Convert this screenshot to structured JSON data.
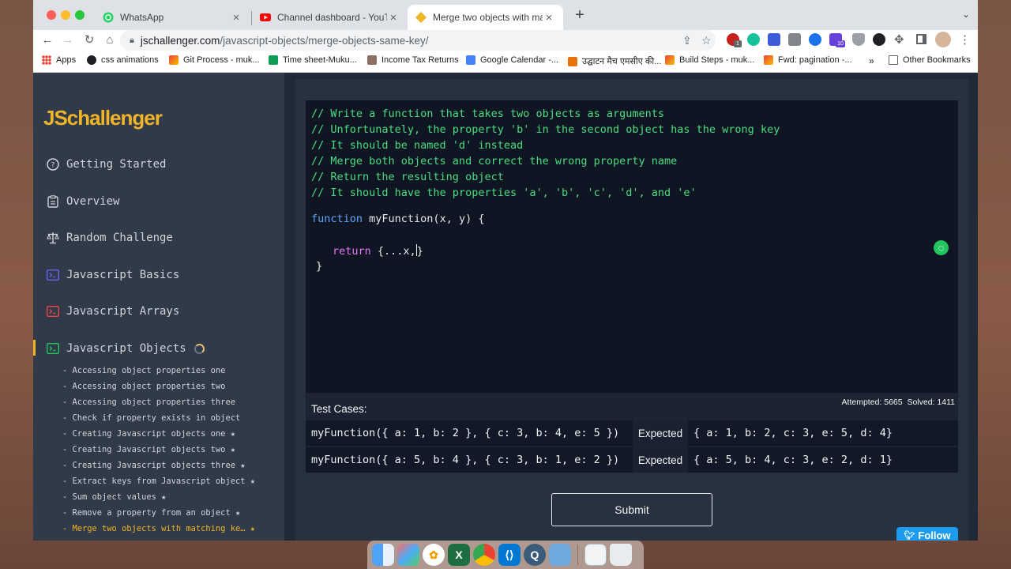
{
  "browser": {
    "tabs": [
      {
        "title": "WhatsApp",
        "icon": "whatsapp-icon",
        "active": false
      },
      {
        "title": "Channel dashboard - YouTube",
        "icon": "youtube-icon",
        "active": false
      },
      {
        "title": "Merge two objects with matchi",
        "icon": "jschallenger-icon",
        "active": true
      }
    ],
    "new_tab": "+",
    "url_host": "jschallenger.com",
    "url_path": "/javascript-objects/merge-objects-same-key/",
    "extension_badges": {
      "first": "1",
      "purple": "10"
    },
    "bookmarks": [
      {
        "label": "Apps",
        "icon": "apps-grid-icon"
      },
      {
        "label": "css animations",
        "icon": "site-icon"
      },
      {
        "label": "Git Process - muk...",
        "icon": "gmail-icon"
      },
      {
        "label": "Time sheet-Muku...",
        "icon": "sheets-icon"
      },
      {
        "label": "Income Tax Returns",
        "icon": "site-icon"
      },
      {
        "label": "Google Calendar -...",
        "icon": "calendar-icon"
      },
      {
        "label": "उद्घाटन मैच एमसीए की...",
        "icon": "news-icon"
      },
      {
        "label": "Build Steps - muk...",
        "icon": "gmail-icon"
      },
      {
        "label": "Fwd: pagination -...",
        "icon": "gmail-icon"
      }
    ],
    "bookmarks_overflow": "»",
    "other_bookmarks": "Other Bookmarks"
  },
  "sidebar": {
    "logo": "JSchallenger",
    "nav": [
      {
        "label": "Getting Started",
        "icon": "question-circle-icon"
      },
      {
        "label": "Overview",
        "icon": "clipboard-icon"
      },
      {
        "label": "Random Challenge",
        "icon": "scale-icon"
      },
      {
        "label": "Javascript Basics",
        "icon": "terminal-icon"
      },
      {
        "label": "Javascript Arrays",
        "icon": "terminal-icon"
      },
      {
        "label": "Javascript Objects",
        "icon": "terminal-icon"
      }
    ],
    "sub_items": [
      "- Accessing object properties one",
      "- Accessing object properties two",
      "- Accessing object properties three",
      "- Check if property exists in object",
      "- Creating Javascript objects one ★",
      "- Creating Javascript objects two ★",
      "- Creating Javascript objects three ★",
      "- Extract keys from Javascript object ★",
      "- Sum object values ★",
      "- Remove a property from an object ★",
      "- Merge two objects with matching ke… ★"
    ]
  },
  "editor": {
    "comments": [
      "// Write a function that takes two objects as arguments",
      "// Unfortunately, the property 'b' in the second object has the wrong key",
      "// It should be named 'd' instead",
      "// Merge both objects and correct the wrong property name",
      "// Return the resulting object",
      "// It should have the properties 'a', 'b', 'c', 'd', and 'e'"
    ],
    "kw_function": "function",
    "signature": " myFunction(x, y) {",
    "kw_return": "return",
    "return_body": " {...x,",
    "return_close": "}",
    "closing": "}"
  },
  "tests": {
    "title": "Test Cases:",
    "attempted_label": "Attempted:",
    "attempted": "5665",
    "solved_label": "Solved:",
    "solved": "1411",
    "expected_label": "Expected",
    "cases": [
      {
        "call": "myFunction({ a: 1, b: 2 }, { c: 3, b: 4, e: 5 })",
        "expected": "{ a: 1, b: 2, c: 3, e: 5, d: 4}"
      },
      {
        "call": "myFunction({ a: 5, b: 4 }, { c: 3, b: 1, e: 2 })",
        "expected": "{ a: 5, b: 4, c: 3, e: 2, d: 1}"
      }
    ]
  },
  "submit_label": "Submit",
  "follow_label": "Follow",
  "colors": {
    "accent": "#f0b429",
    "comment": "#4ade80",
    "keyword": "#60a5fa",
    "return": "#e879f9"
  }
}
